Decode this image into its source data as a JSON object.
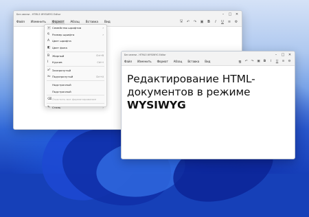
{
  "window_back": {
    "title": "Без имени - HTML5 WYSIWYG Editor",
    "menu": [
      "Файл",
      "Изменить",
      "Формат",
      "Абзац",
      "Вставка",
      "Вид"
    ],
    "active_menu": "Формат"
  },
  "window_front": {
    "title": "Без имени - HTML5 WYSIWYG Editor",
    "menu": [
      "Файл",
      "Изменить",
      "Формат",
      "Абзац",
      "Вставка",
      "Вид"
    ],
    "doc_text_normal": "Редактирование HTML-документов в режиме ",
    "doc_text_bold": "WYSIWYG"
  },
  "toolbar_icons": [
    "save-icon",
    "undo-icon",
    "redo-icon",
    "image-icon",
    "bold-icon",
    "italic-icon",
    "underline-icon",
    "list-icon",
    "settings-icon"
  ],
  "toolbar_glyphs": [
    "🖫",
    "↶",
    "↷",
    "▣",
    "B",
    "I",
    "U",
    "≡",
    "⚙"
  ],
  "format_menu": [
    {
      "icon": "🄰",
      "label": "Семейство шрифтов",
      "shortcut": "",
      "submenu": true,
      "disabled": false
    },
    {
      "icon": "ꟼ",
      "label": "Размер шрифта",
      "shortcut": "",
      "submenu": true,
      "disabled": false
    },
    {
      "icon": "A",
      "label": "Цвет шрифта",
      "shortcut": "",
      "submenu": false,
      "disabled": false
    },
    {
      "icon": "◧",
      "label": "Цвет фона",
      "shortcut": "",
      "submenu": false,
      "disabled": false
    },
    {
      "sep": true
    },
    {
      "icon": "B",
      "label": "Жирный",
      "shortcut": "Ctrl+B",
      "submenu": false,
      "disabled": false
    },
    {
      "icon": "I",
      "label": "Курсив",
      "shortcut": "Ctrl+I",
      "submenu": false,
      "disabled": false
    },
    {
      "sep": true
    },
    {
      "icon": "x²",
      "label": "Зачеркнутый",
      "shortcut": "",
      "submenu": false,
      "disabled": false
    },
    {
      "icon": "x₂",
      "label": "Подчеркнутый",
      "shortcut": "Ctrl+U",
      "submenu": false,
      "disabled": false
    },
    {
      "sep": true
    },
    {
      "icon": "",
      "label": "Надстрочный",
      "shortcut": "",
      "submenu": false,
      "disabled": false
    },
    {
      "icon": "",
      "label": "Подстрочный",
      "shortcut": "",
      "submenu": false,
      "disabled": false
    },
    {
      "sep": true
    },
    {
      "icon": "⌫",
      "label": "Очистить все форматирование",
      "shortcut": "",
      "submenu": false,
      "disabled": true
    },
    {
      "sep": true
    },
    {
      "icon": "✎",
      "label": "Стиль",
      "shortcut": "",
      "submenu": true,
      "disabled": false
    }
  ]
}
